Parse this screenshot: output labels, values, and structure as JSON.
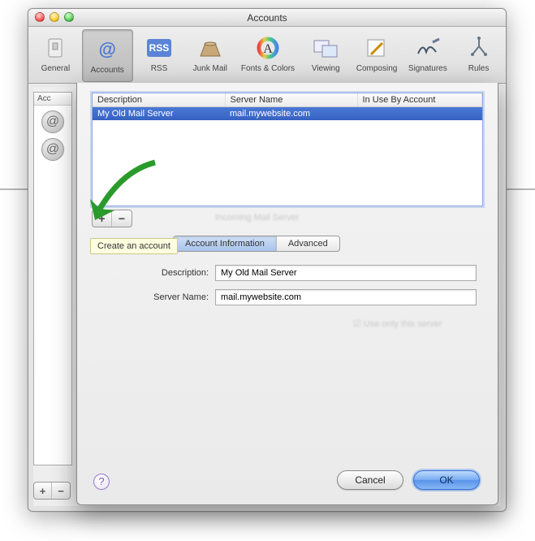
{
  "window": {
    "title": "Accounts"
  },
  "toolbar": {
    "items": [
      {
        "label": "General",
        "icon": "switch-icon"
      },
      {
        "label": "Accounts",
        "icon": "at-icon",
        "selected": true
      },
      {
        "label": "RSS",
        "icon": "rss-icon"
      },
      {
        "label": "Junk Mail",
        "icon": "junk-icon"
      },
      {
        "label": "Fonts & Colors",
        "icon": "fonts-icon"
      },
      {
        "label": "Viewing",
        "icon": "viewing-icon"
      },
      {
        "label": "Composing",
        "icon": "composing-icon"
      },
      {
        "label": "Signatures",
        "icon": "signatures-icon"
      },
      {
        "label": "Rules",
        "icon": "rules-icon"
      }
    ]
  },
  "sidebar": {
    "header": "Acc"
  },
  "sheet": {
    "columns": {
      "description": "Description",
      "server": "Server Name",
      "inuse": "In Use By Account"
    },
    "rows": [
      {
        "description": "My Old Mail Server",
        "server": "mail.mywebsite.com",
        "inuse": ""
      }
    ],
    "tooltip": "Create an account",
    "tabs": {
      "info": "Account Information",
      "advanced": "Advanced"
    },
    "form": {
      "description_label": "Description:",
      "description_value": "My Old Mail Server",
      "server_label": "Server Name:",
      "server_value": "mail.mywebsite.com"
    },
    "buttons": {
      "cancel": "Cancel",
      "ok": "OK"
    },
    "ghost": {
      "incoming": "Incoming Mail Server",
      "useonly": "Use only this server"
    }
  },
  "glyphs": {
    "plus": "+",
    "minus": "−",
    "help": "?"
  }
}
